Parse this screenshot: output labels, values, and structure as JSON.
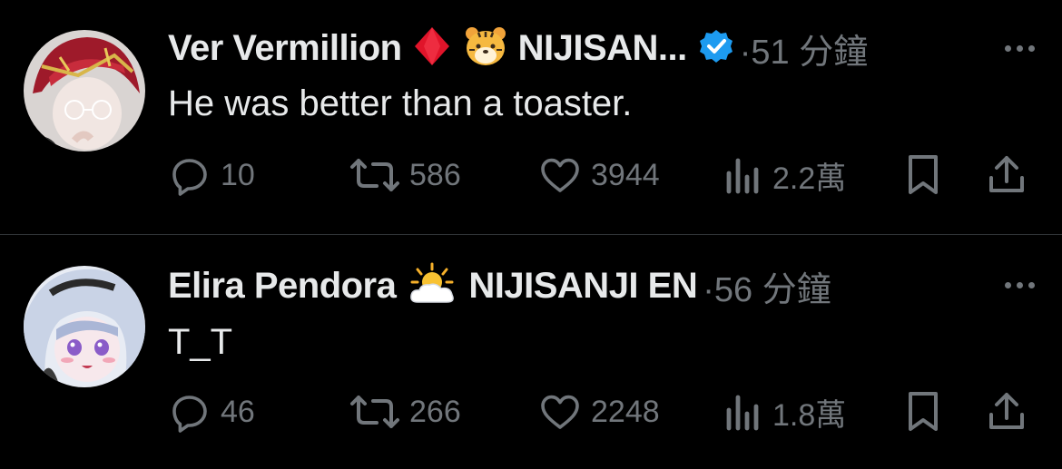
{
  "tweets": [
    {
      "name": "Ver Vermillion",
      "emoji1": "♦",
      "emoji2": "🐯",
      "org": "NIJISAN...",
      "verified": true,
      "time": "51 分鐘",
      "text": "He was better than a toaster.",
      "replies": "10",
      "retweets": "586",
      "likes": "3944",
      "views": "2.2萬"
    },
    {
      "name": "Elira Pendora",
      "emoji1": "⛅",
      "org": "NIJISANJI EN",
      "verified": false,
      "time": "56 分鐘",
      "text": "T_T",
      "replies": "46",
      "retweets": "266",
      "likes": "2248",
      "views": "1.8萬"
    }
  ],
  "colors": {
    "background": "#000000",
    "text": "#e7e9ea",
    "muted": "#71767b",
    "verified": "#1d9bf0",
    "divider": "#2f3336"
  }
}
